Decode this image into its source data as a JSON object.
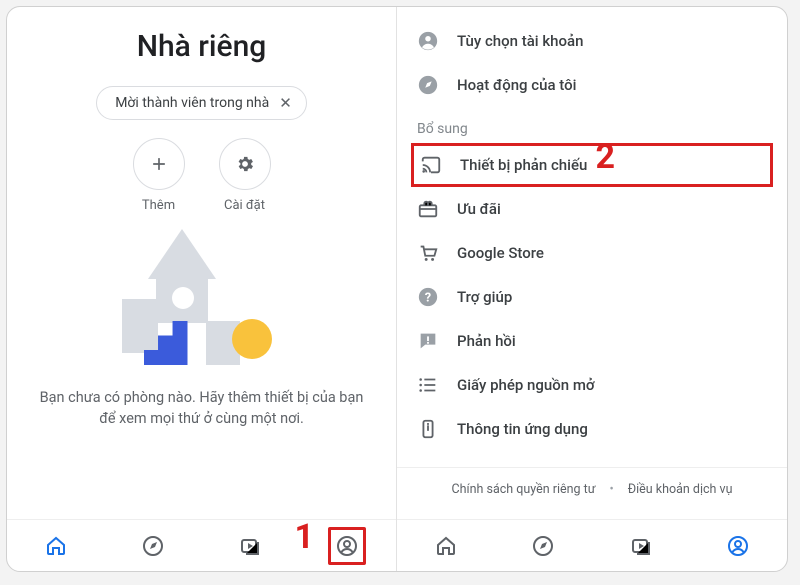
{
  "left": {
    "title": "Nhà riêng",
    "chip_label": "Mời thành viên trong nhà",
    "actions": {
      "add": "Thêm",
      "settings": "Cài đặt"
    },
    "empty_text": "Bạn chưa có phòng nào. Hãy thêm thiết bị của bạn để xem mọi thứ ở cùng một nơi.",
    "annotation": "1"
  },
  "right": {
    "items_top": [
      {
        "label": "Tùy chọn tài khoản"
      },
      {
        "label": "Hoạt động của tôi"
      }
    ],
    "section_label": "Bổ sung",
    "highlighted": {
      "label": "Thiết bị phản chiếu"
    },
    "items_rest": [
      {
        "label": "Ưu đãi"
      },
      {
        "label": "Google Store"
      },
      {
        "label": "Trợ giúp"
      },
      {
        "label": "Phản hồi"
      },
      {
        "label": "Giấy phép nguồn mở"
      },
      {
        "label": "Thông tin ứng dụng"
      }
    ],
    "footer": {
      "privacy": "Chính sách quyền riêng tư",
      "terms": "Điều khoản dịch vụ"
    },
    "annotation": "2"
  }
}
